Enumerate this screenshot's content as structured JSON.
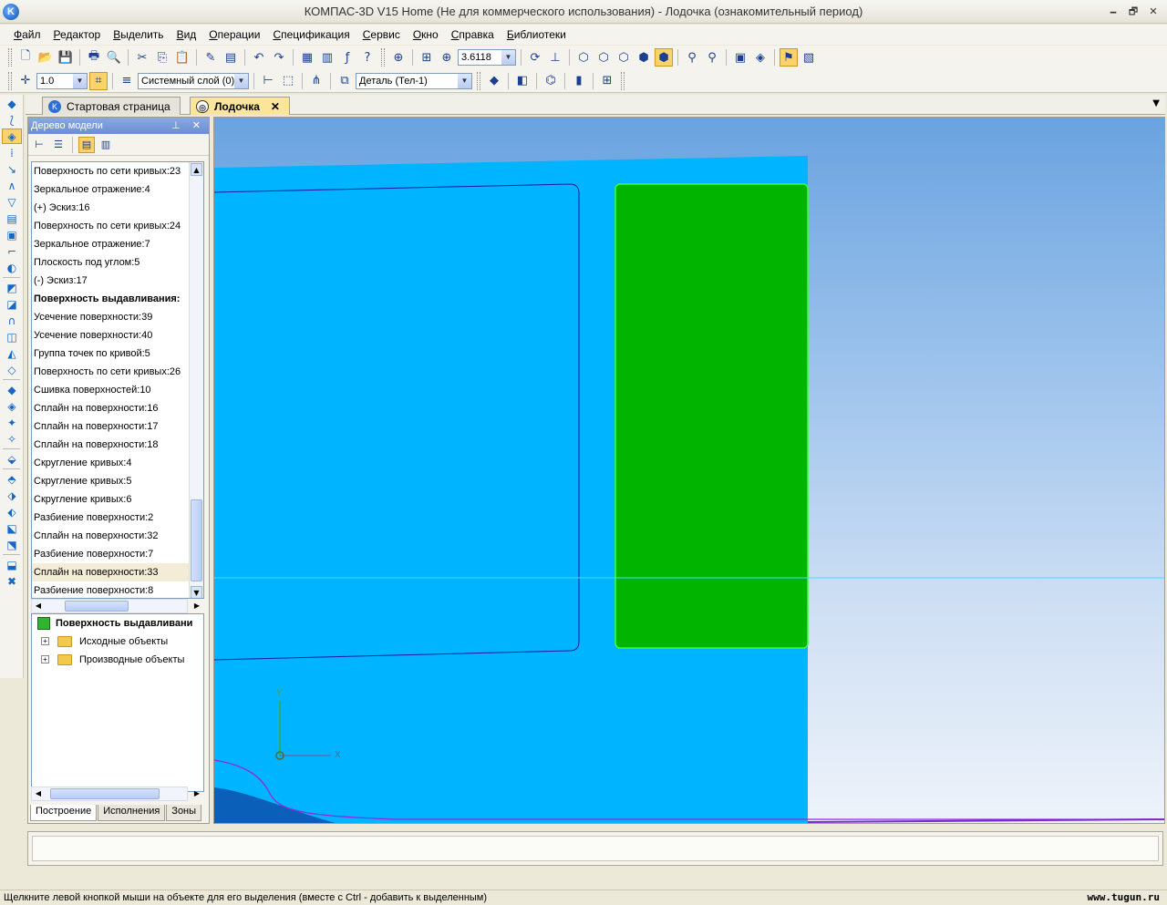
{
  "window": {
    "title": "КОМПАС-3D V15 Home (Не для коммерческого использования) - Лодочка (ознакомительный период)",
    "app_icon_letter": "K",
    "minimize": "🗕",
    "restore": "🗗",
    "close": "✕"
  },
  "menu": [
    "Файл",
    "Редактор",
    "Выделить",
    "Вид",
    "Операции",
    "Спецификация",
    "Сервис",
    "Окно",
    "Справка",
    "Библиотеки"
  ],
  "toolbar": {
    "zoom_value": "3.6118",
    "step_value": "1.0",
    "layer_value": "Системный слой (0)",
    "part_value": "Деталь (Тел-1)"
  },
  "tabs": [
    {
      "label": "Стартовая страница",
      "active": false
    },
    {
      "label": "Лодочка",
      "active": true,
      "close": "✕"
    }
  ],
  "model_tree": {
    "title": "Дерево модели",
    "header_buttons": "⊥ ✕",
    "items": [
      {
        "label": "Поверхность по сети кривых:23"
      },
      {
        "label": "Зеркальное отражение:4"
      },
      {
        "label": "(+) Эскиз:16"
      },
      {
        "label": "Поверхность по сети кривых:24"
      },
      {
        "label": "Зеркальное отражение:7"
      },
      {
        "label": "Плоскость под углом:5"
      },
      {
        "label": "(-) Эскиз:17"
      },
      {
        "label": "Поверхность выдавливания:"
      },
      {
        "label": "Усечение поверхности:39"
      },
      {
        "label": "Усечение поверхности:40"
      },
      {
        "label": "Группа точек по кривой:5"
      },
      {
        "label": "Поверхность по сети кривых:26"
      },
      {
        "label": "Сшивка поверхностей:10"
      },
      {
        "label": "Сплайн на поверхности:16"
      },
      {
        "label": "Сплайн на поверхности:17"
      },
      {
        "label": "Сплайн на поверхности:18"
      },
      {
        "label": "Скругление кривых:4"
      },
      {
        "label": "Скругление кривых:5"
      },
      {
        "label": "Скругление кривых:6"
      },
      {
        "label": "Разбиение поверхности:2"
      },
      {
        "label": "Сплайн на поверхности:32"
      },
      {
        "label": "Разбиение поверхности:7"
      },
      {
        "label": "Сплайн на поверхности:33"
      },
      {
        "label": "Разбиение поверхности:8"
      }
    ],
    "selected_root": "Поверхность выдавливани",
    "children": [
      "Исходные объекты",
      "Производные объекты"
    ],
    "tabs": [
      "Построение",
      "Исполнения",
      "Зоны"
    ]
  },
  "viewport": {
    "axis_x": "X",
    "axis_y": "Y",
    "body_color": "#00b4ff",
    "selected_face_color": "#00b400",
    "accent_line_color": "#1a1aa0"
  },
  "status": {
    "text": "Щелкните левой кнопкой мыши на объекте для его выделения (вместе с Ctrl - добавить к выделенным)",
    "watermark": "www.tugun.ru"
  }
}
